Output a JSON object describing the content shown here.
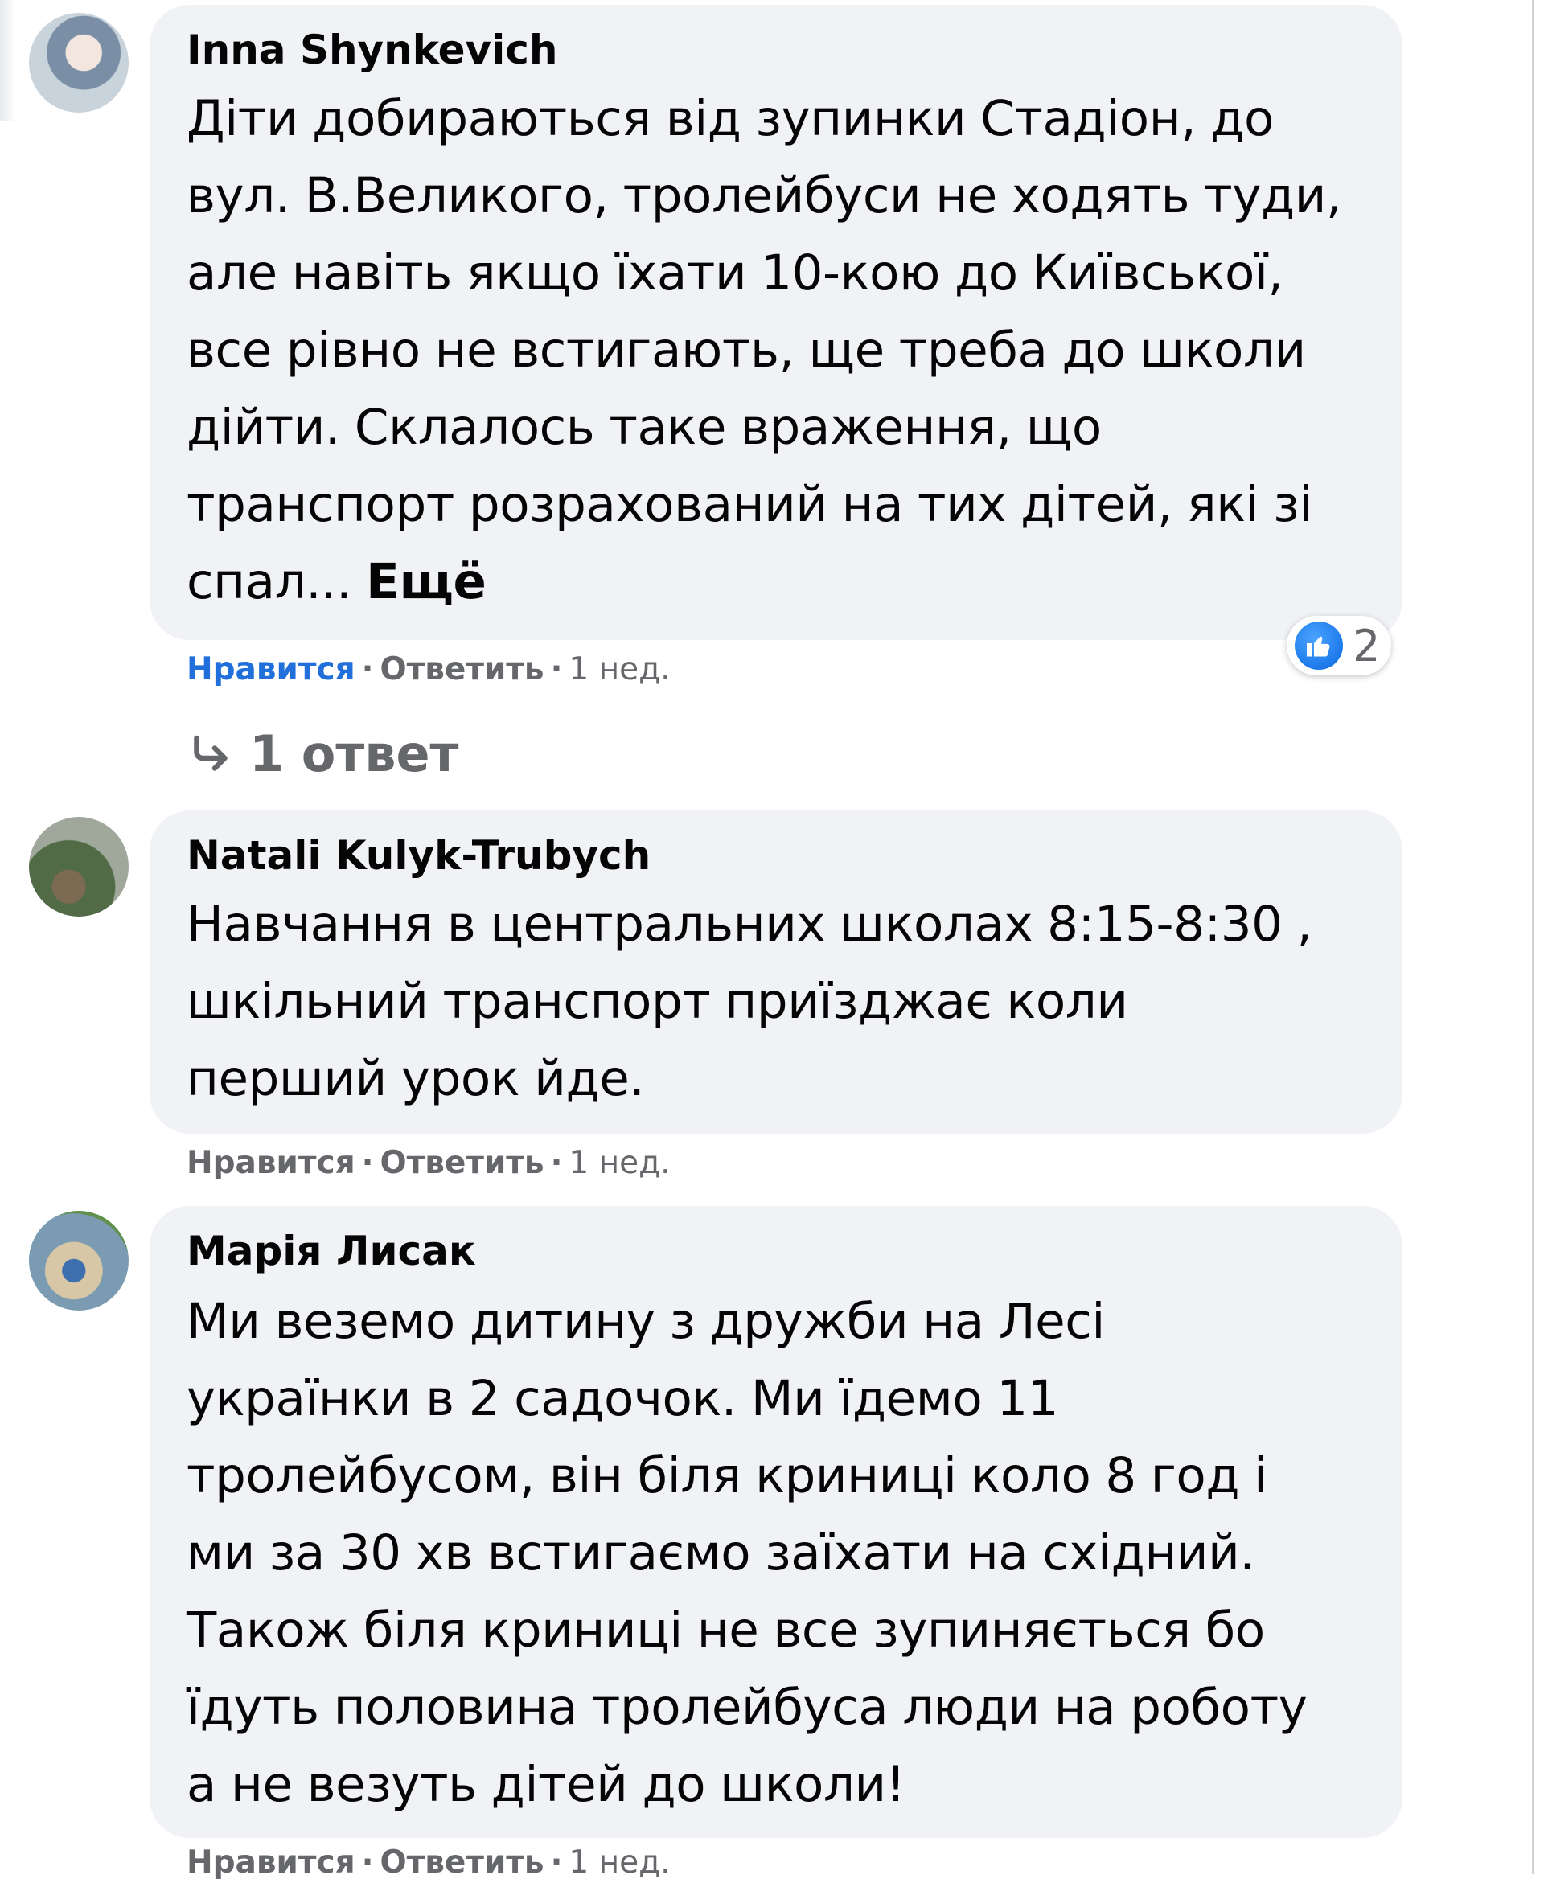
{
  "comments": [
    {
      "author": "Inna Shynkevich",
      "lines": [
        "Діти добираються від зупинки Стадіон, до",
        "вул. В.Великого, тролейбуси не ходять туди,",
        "але навіть якщо їхати 10-кою до Київської,",
        "все рівно не встигають, ще треба до школи",
        "дійти. Склалось таке враження, що",
        "транспорт розрахований на тих дітей, які зі"
      ],
      "last_line": "спал...",
      "more_label": "Ещё",
      "reaction_icon": "like-icon",
      "reaction_count": "2",
      "like_label": "Нравится",
      "reply_label": "Ответить",
      "time": "1 нед.",
      "replies_label": "1 ответ"
    },
    {
      "author": "Natali Kulyk-Trubych",
      "lines": [
        "Навчання в центральних школах 8:15-8:30 ,",
        "шкільний транспорт приїзджає коли",
        "перший урок йде."
      ],
      "like_label": "Нравится",
      "reply_label": "Ответить",
      "time": "1 нед."
    },
    {
      "author": "Марія Лисак",
      "lines": [
        "Ми веземо дитину з дружби на Лесі",
        "українки в 2 садочок. Ми їдемо 11",
        "тролейбусом, він біля криниці коло 8 год і",
        "ми за 30 хв встигаємо заїхати на східний.",
        "Також біля криниці не все зупиняється бо",
        "їдуть половина тролейбуса люди на роботу",
        "а не везуть дітей до школи!"
      ],
      "like_label": "Нравится",
      "reply_label": "Ответить",
      "time": "1 нед."
    }
  ],
  "colors": {
    "bubble_bg": "#f0f2f5",
    "meta_text": "#65676b",
    "liked_blue": "#216fdb",
    "reaction_blue": "#0a68e0"
  }
}
